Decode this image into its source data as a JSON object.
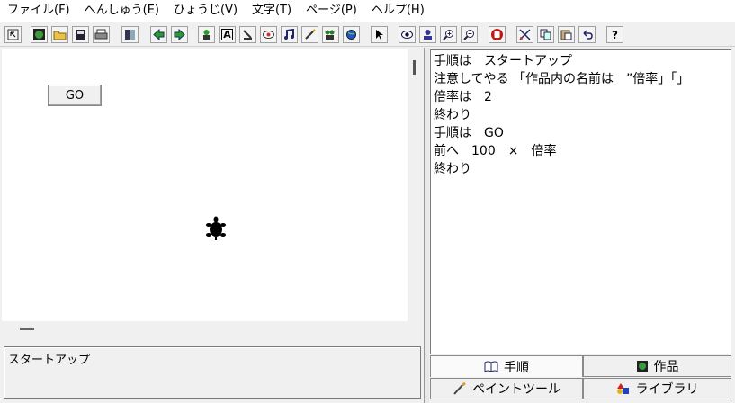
{
  "menu": [
    "ファイル(F)",
    "へんしゅう(E)",
    "ひょうじ(V)",
    "文字(T)",
    "ページ(P)",
    "ヘルプ(H)"
  ],
  "toolbar": {
    "help_glyph": "?",
    "label_tool_glyph": "A"
  },
  "stage": {
    "go_button": "GO"
  },
  "message": {
    "text": "スタートアップ"
  },
  "editor": {
    "lines": [
      "手順は　スタートアップ",
      "注意してやる 「作品内の名前は　”倍率」「」",
      "倍率は　2",
      "終わり",
      "手順は　GO",
      "前へ　100　×　倍率",
      "終わり"
    ]
  },
  "tabs": {
    "procedure": "手順",
    "works": "作品",
    "paint_tool": "ペイントツール",
    "library": "ライブラリ"
  }
}
